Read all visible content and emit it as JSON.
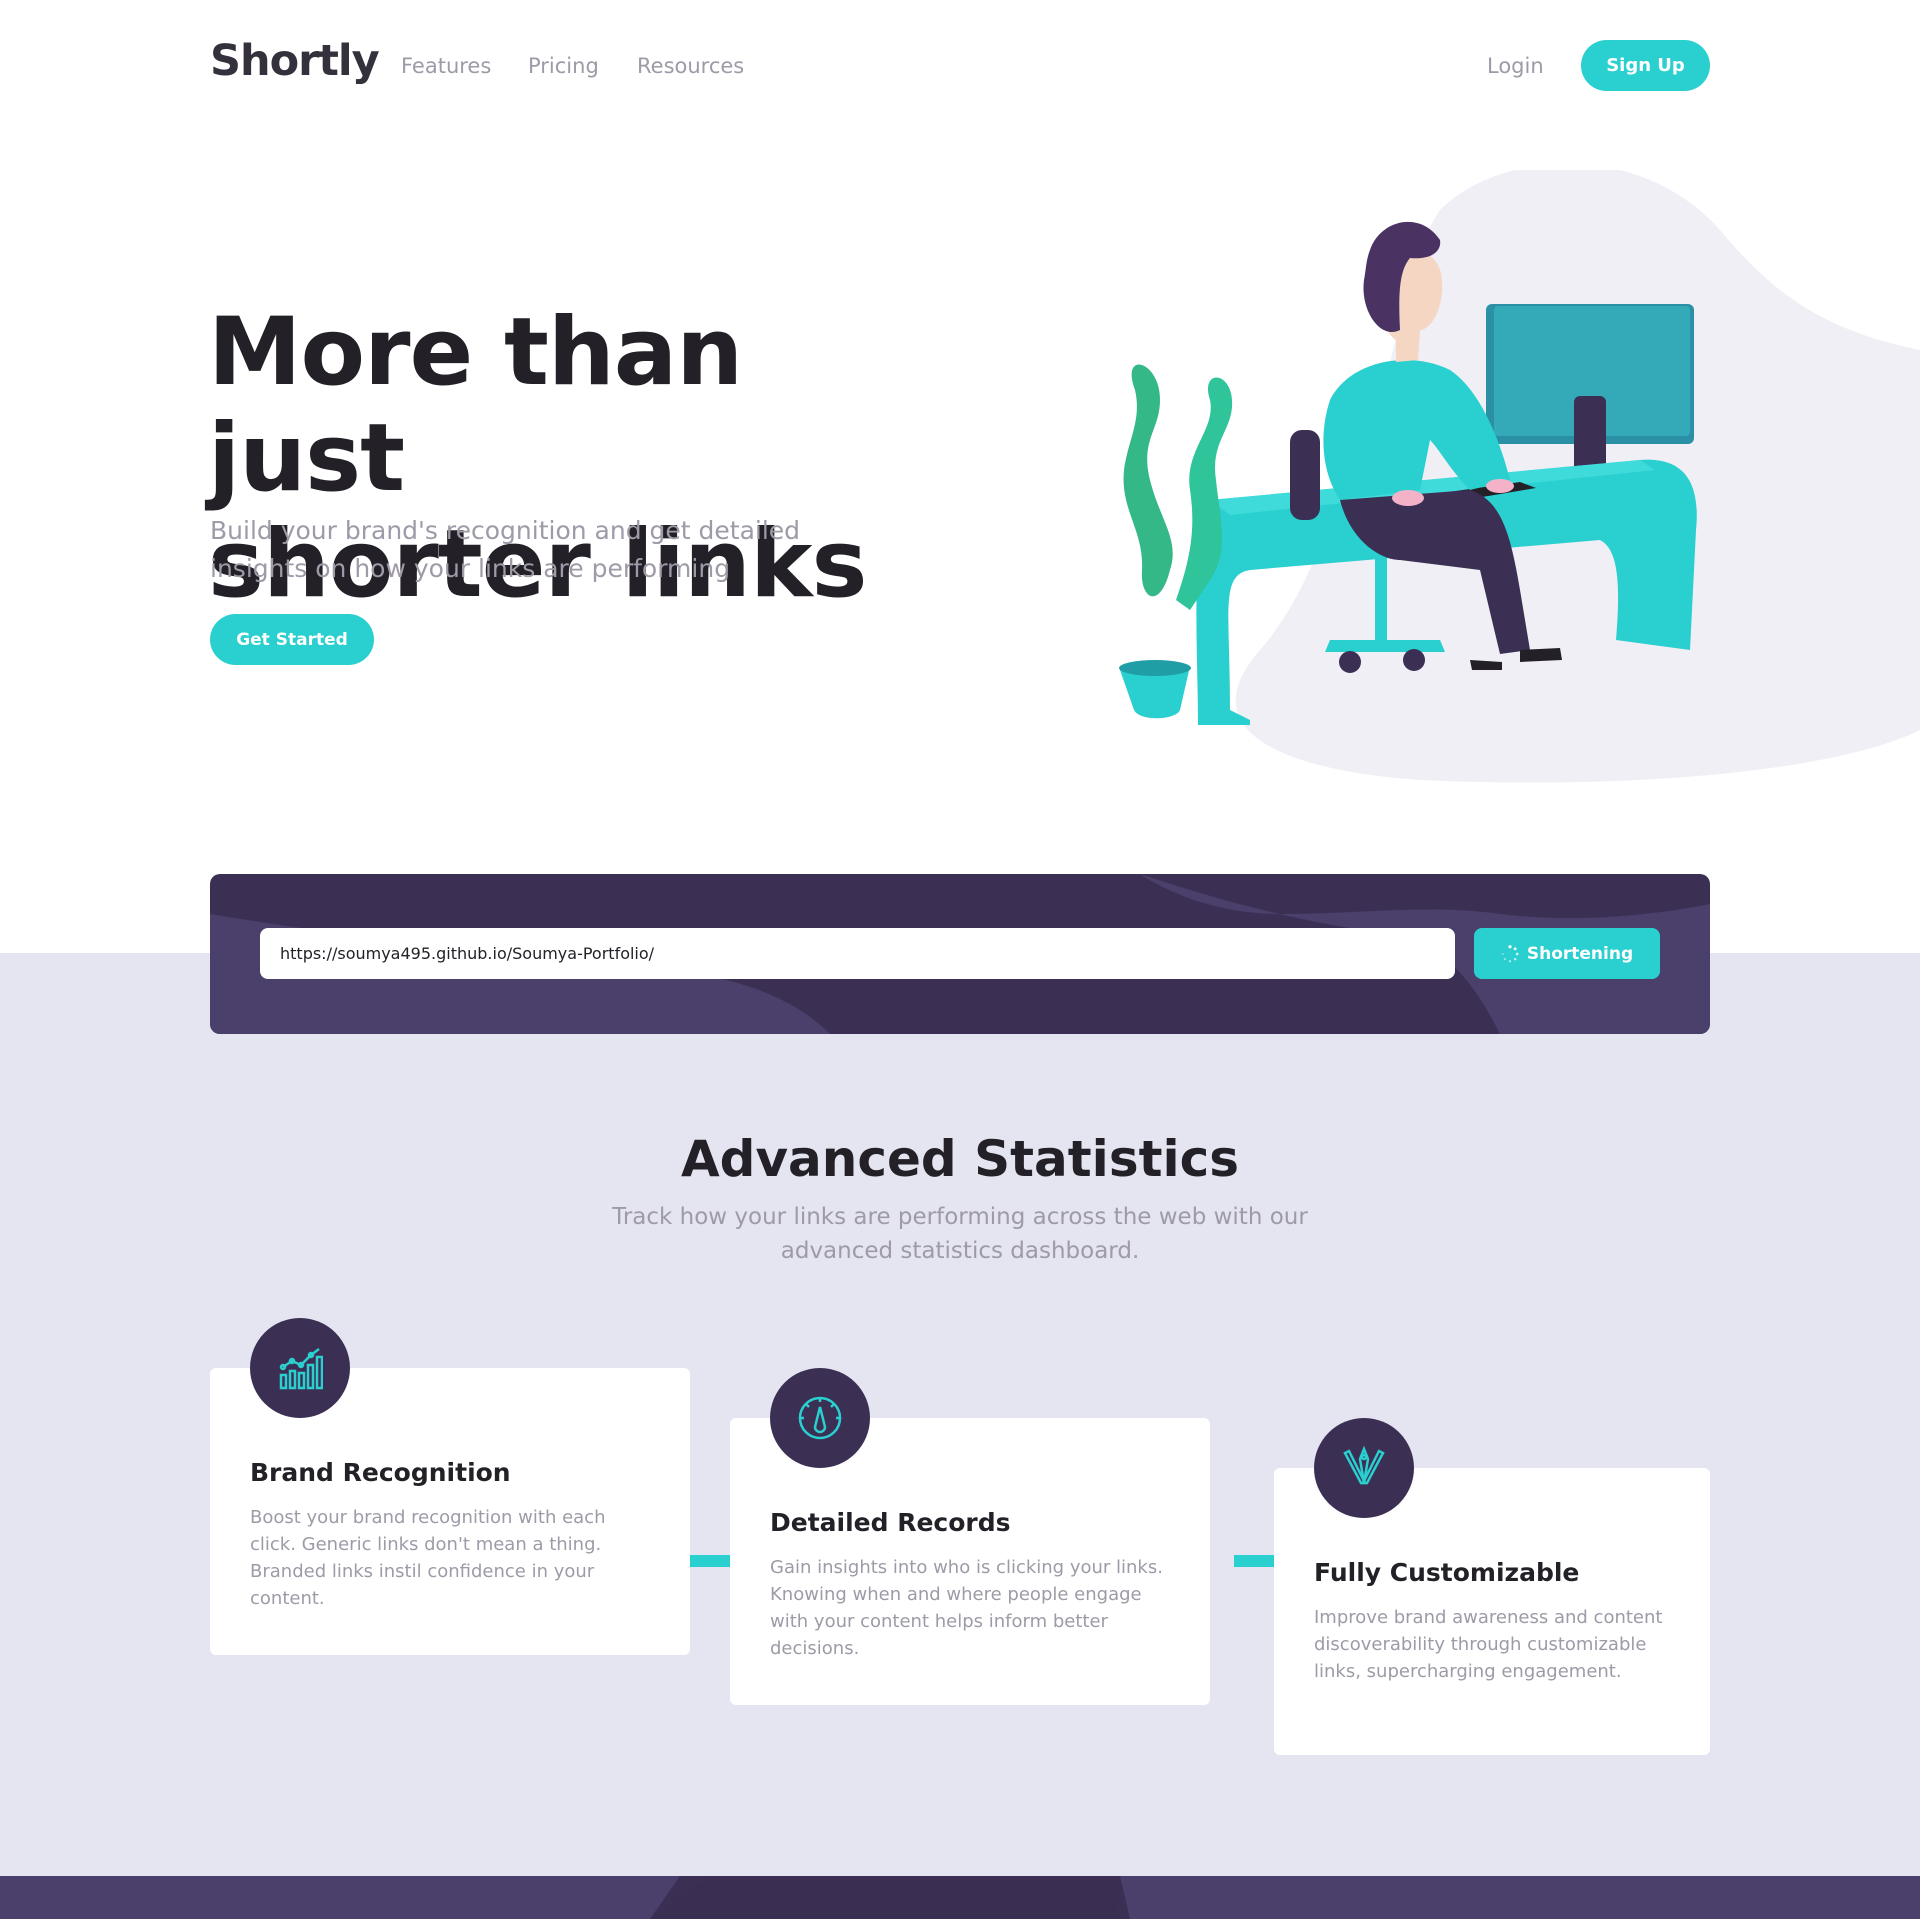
{
  "nav": {
    "logo": "Shortly",
    "links": [
      "Features",
      "Pricing",
      "Resources"
    ],
    "login": "Login",
    "signup": "Sign Up"
  },
  "hero": {
    "title_line1": "More than just",
    "title_line2": "shorter links",
    "subtitle": "Build your brand's recognition and get detailed insights on how your links are performing",
    "cta": "Get Started"
  },
  "shorten": {
    "input_value": "https://soumya495.github.io/Soumya-Portfolio/",
    "button_label": "Shortening"
  },
  "stats": {
    "title": "Advanced Statistics",
    "subtitle": "Track how your links are performing across the web with our advanced statistics dashboard.",
    "cards": [
      {
        "icon": "brand-recognition-icon",
        "title": "Brand Recognition",
        "text": "Boost your brand recognition with each click. Generic links don't mean a thing. Branded links instil confidence in your content."
      },
      {
        "icon": "detailed-records-icon",
        "title": "Detailed Records",
        "text": "Gain insights into who is clicking your links. Knowing when and where people engage with your content helps inform better decisions."
      },
      {
        "icon": "fully-customizable-icon",
        "title": "Fully Customizable",
        "text": "Improve brand awareness and content discoverability through customizable links, supercharging engagement."
      }
    ]
  },
  "colors": {
    "cyan": "#2acfcf",
    "dark_violet": "#3b3054",
    "grey": "#9e9aa7",
    "very_dark_blue": "#232127",
    "light_grey_bg": "#e4e5f0"
  }
}
